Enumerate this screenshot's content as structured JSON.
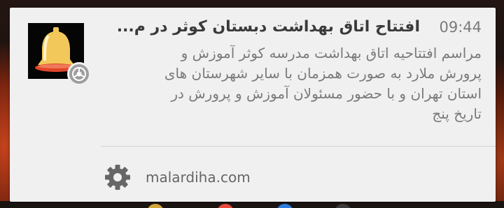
{
  "notification": {
    "app_icon": "bell-icon",
    "badge_icon": "chrome-icon",
    "time": "09:44",
    "title": "افتتاح اتاق بهداشت دبستان کوثر در م...",
    "body_lines": [
      "مراسم افتتاحیه اتاق بهداشت مدرسه کوثر آموزش و",
      "پرورش ملارد به صورت همزمان با سایر شهرستان های",
      "استان تهران و با حضور مسئولان آموزش و پرورش در",
      "تاریخ پنج"
    ],
    "settings_icon": "gear-icon",
    "source_domain": "malardiha.com"
  },
  "colors": {
    "card_background": "#f0f0f0",
    "title_text": "#3a3a3a",
    "secondary_text": "#7a7a7a",
    "bell_body": "#f2c85a",
    "bell_base": "#e0462a"
  }
}
